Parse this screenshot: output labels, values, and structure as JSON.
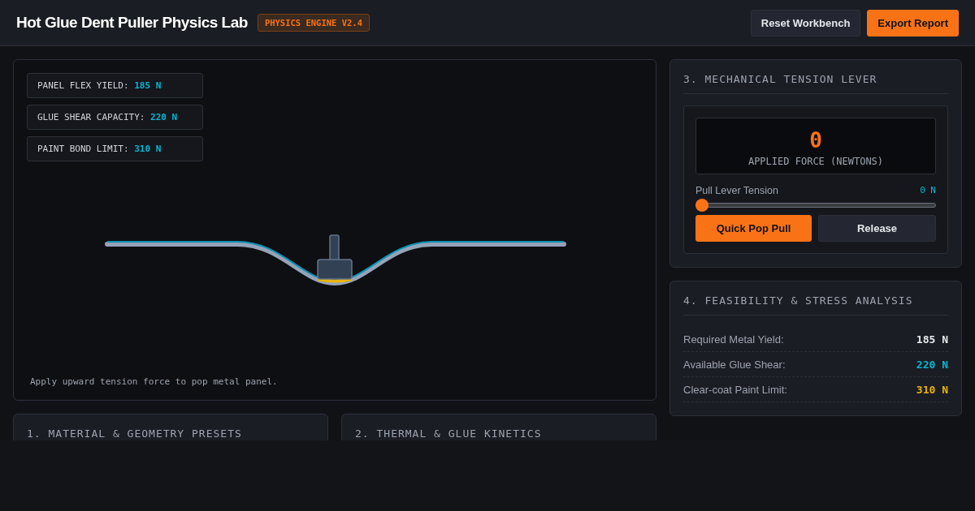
{
  "header": {
    "title": "Hot Glue Dent Puller Physics Lab",
    "badge": "PHYSICS ENGINE V2.4",
    "buttons": [
      {
        "label": "Reset Workbench",
        "kind": "secondary"
      },
      {
        "label": "Export Report",
        "kind": "primary"
      }
    ]
  },
  "simulation": {
    "readouts": [
      {
        "label": "PANEL FLEX YIELD:",
        "value": "185 N"
      },
      {
        "label": "GLUE SHEAR CAPACITY:",
        "value": "220 N"
      },
      {
        "label": "PAINT BOND LIMIT:",
        "value": "310 N"
      }
    ],
    "caption": "Apply upward tension force to pop metal panel."
  },
  "lever": {
    "title": "3. MECHANICAL TENSION LEVER",
    "force": "0",
    "force_label": "APPLIED FORCE (NEWTONS)",
    "slider_label": "Pull Lever Tension",
    "slider_reading": "0 N",
    "level": 0,
    "buttons": [
      {
        "label": "Quick Pop Pull",
        "kind": "primary"
      },
      {
        "label": "Release",
        "kind": "secondary"
      }
    ]
  },
  "analysis": {
    "title": "4. FEASIBILITY & STRESS ANALYSIS",
    "rows": [
      {
        "label": "Required Metal Yield:",
        "value": "185 N",
        "color": "#e5e7eb"
      },
      {
        "label": "Available Glue Shear:",
        "value": "220 N",
        "color": "#06b6d4"
      },
      {
        "label": "Clear-coat Paint Limit:",
        "value": "310 N",
        "color": "#eab308"
      }
    ]
  },
  "panels": [
    {
      "title": "1. MATERIAL & GEOMETRY PRESETS"
    },
    {
      "title": "2. THERMAL & GLUE KINETICS"
    }
  ]
}
